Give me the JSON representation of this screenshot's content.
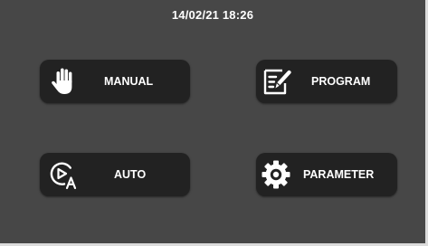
{
  "status_bar": {
    "datetime": "14/02/21 18:26"
  },
  "menu": {
    "manual": {
      "label": "MANUAL",
      "icon": "hand-icon"
    },
    "program": {
      "label": "PROGRAM",
      "icon": "edit-document-icon"
    },
    "auto": {
      "label": "AUTO",
      "icon": "auto-play-icon"
    },
    "parameter": {
      "label": "PARAMETER",
      "icon": "gear-icon"
    }
  },
  "colors": {
    "background": "#474747",
    "button": "#222222",
    "text": "#ffffff"
  }
}
